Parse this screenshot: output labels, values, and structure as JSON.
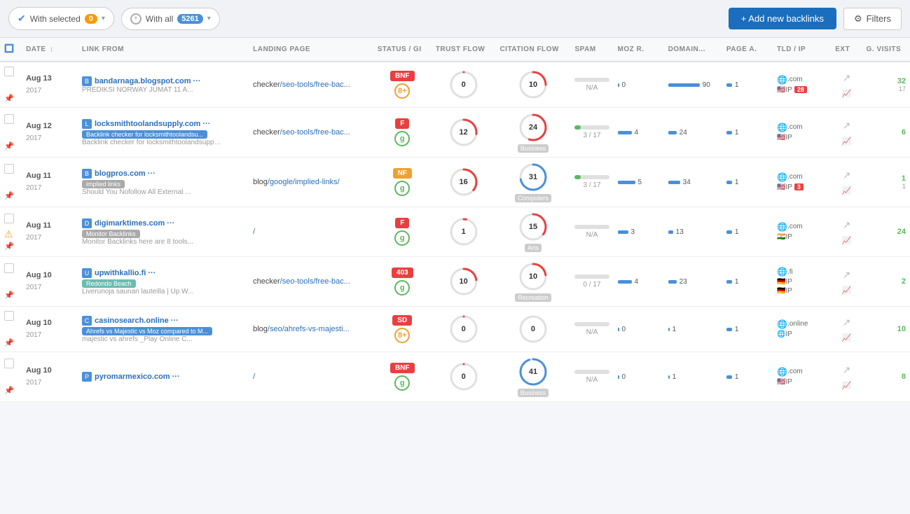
{
  "toolbar": {
    "with_selected_label": "With selected",
    "with_selected_count": "0",
    "with_all_label": "With all",
    "with_all_count": "5261",
    "add_backlinks_label": "+ Add new backlinks",
    "filters_label": "Filters"
  },
  "table": {
    "headers": [
      {
        "key": "date",
        "label": "DATE",
        "sortable": true
      },
      {
        "key": "link",
        "label": "LINK FROM",
        "sortable": false
      },
      {
        "key": "landing",
        "label": "LANDING PAGE",
        "sortable": false
      },
      {
        "key": "status",
        "label": "STATUS / GI",
        "sortable": false
      },
      {
        "key": "trust",
        "label": "TRUST FLOW",
        "sortable": false
      },
      {
        "key": "citation",
        "label": "CITATION FLOW",
        "sortable": false
      },
      {
        "key": "spam",
        "label": "SPAM",
        "sortable": false
      },
      {
        "key": "moz_r",
        "label": "MOZ R.",
        "sortable": false
      },
      {
        "key": "domain",
        "label": "DOMAIN...",
        "sortable": false
      },
      {
        "key": "page_a",
        "label": "PAGE A.",
        "sortable": false
      },
      {
        "key": "tld_ip",
        "label": "TLD / IP",
        "sortable": false
      },
      {
        "key": "ext",
        "label": "EXT",
        "sortable": false
      },
      {
        "key": "g_visits",
        "label": "G. VISITS",
        "sortable": false
      }
    ],
    "rows": [
      {
        "date": {
          "day": "Aug 13",
          "year": "2017"
        },
        "link_domain": "bandarnaga.blogspot.com",
        "link_sub": "PREDIKSI NORWAY JUMAT 11 A...",
        "link_tag": null,
        "link_icon": "blog",
        "landing_prefix": "checker",
        "landing_path": "/seo-tools/free-bac...",
        "status_code": "BNF",
        "status_class": "status-bnf",
        "g_icon_class": "g-orange",
        "g_icon_text": "8+",
        "trust_val": 0,
        "trust_arc_color": "#e84040",
        "trust_arc_pct": 0,
        "citation_val": 10,
        "citation_arc_color": "#e84040",
        "citation_arc_pct": 25,
        "spam_val": "N/A",
        "spam_bar_pct": 0,
        "moz_r_val": 0,
        "moz_r_bar": 0,
        "domain_val": 90,
        "domain_bar": 90,
        "page_a_val": 1,
        "tld": ".com",
        "ip_flag": "🇺🇸",
        "ip_badge": "28",
        "ip_badge_class": "ip-red",
        "ext_icon": "↗",
        "visits_val": "32",
        "visits_sub": "17",
        "has_warning": false
      },
      {
        "date": {
          "day": "Aug 12",
          "year": "2017"
        },
        "link_domain": "locksmithtoolandsupply.com",
        "link_sub": "Backlink checker for locksmithtoolandsupply...",
        "link_tag": "Backlink checker for locksmithtoolandsu...",
        "link_tag_text": "Backlink checker for locksmithtoolandsu...",
        "link_tag_class": "tag-blue",
        "link_icon": "list",
        "landing_prefix": "checker",
        "landing_path": "/seo-tools/free-bac...",
        "status_code": "F",
        "status_class": "status-f",
        "g_icon_class": "g-green",
        "g_icon_text": "g",
        "trust_val": 12,
        "trust_arc_color": "#e84040",
        "trust_arc_pct": 27,
        "citation_val": 24,
        "citation_arc_color": "#e84040",
        "citation_arc_pct": 55,
        "citation_category": "Business",
        "spam_val": "3 / 17",
        "spam_bar_pct": 18,
        "moz_r_val": 4,
        "moz_r_bar": 15,
        "domain_val": 24,
        "domain_bar": 24,
        "page_a_val": 1,
        "tld": ".com",
        "ip_flag": "🇺🇸",
        "ip_badge": null,
        "ip_badge_class": null,
        "ext_icon": "↗",
        "visits_val": "6",
        "visits_sub": "",
        "has_warning": false
      },
      {
        "date": {
          "day": "Aug 11",
          "year": "2017"
        },
        "link_domain": "blogpros.com",
        "link_sub": "Should You Nofollow All External ...",
        "link_tag_text": "implied links",
        "link_tag_class": "tag-gray",
        "link_icon": "b",
        "landing_prefix": "blog",
        "landing_path": "/google/implied-links/",
        "status_code": "NF",
        "status_class": "status-nf",
        "g_icon_class": "g-green",
        "g_icon_text": "g",
        "trust_val": 16,
        "trust_arc_color": "#e84040",
        "trust_arc_pct": 36,
        "citation_val": 31,
        "citation_arc_color": "#4a90d9",
        "citation_arc_pct": 72,
        "citation_category": "Computers",
        "spam_val": "3 / 17",
        "spam_bar_pct": 18,
        "moz_r_val": 5,
        "moz_r_bar": 20,
        "domain_val": 34,
        "domain_bar": 34,
        "page_a_val": 1,
        "tld": ".com",
        "ip_flag": "🇺🇸",
        "ip_badge": "3",
        "ip_badge_class": "ip-red",
        "ext_icon": "↗",
        "visits_val": "1",
        "visits_sub": "1",
        "has_warning": false
      },
      {
        "date": {
          "day": "Aug 11",
          "year": "2017"
        },
        "link_domain": "digimarktimes.com",
        "link_sub": "Monitor Backlinks here are 8 tools...",
        "link_tag_text": "Monitor Backlinks",
        "link_tag_class": "tag-gray",
        "link_icon": "d",
        "landing_prefix": "",
        "landing_path": "/",
        "status_code": "F",
        "status_class": "status-f",
        "g_icon_class": "g-green",
        "g_icon_text": "g",
        "trust_val": 1,
        "trust_arc_color": "#e84040",
        "trust_arc_pct": 3,
        "citation_val": 15,
        "citation_arc_color": "#e84040",
        "citation_arc_pct": 35,
        "citation_category": "Arts",
        "spam_val": "N/A",
        "spam_bar_pct": 0,
        "moz_r_val": 3,
        "moz_r_bar": 12,
        "domain_val": 13,
        "domain_bar": 13,
        "page_a_val": 1,
        "tld": ".com",
        "ip_flag": "🇮🇳",
        "ip_badge": null,
        "ip_badge_class": null,
        "ext_icon": "↗",
        "visits_val": "24",
        "visits_sub": "",
        "has_warning": true
      },
      {
        "date": {
          "day": "Aug 10",
          "year": "2017"
        },
        "link_domain": "upwithkallio.fi",
        "link_sub": "Liverunoja saunan lauteilla | Up W...",
        "link_tag_text": "Redondo Beach",
        "link_tag_class": "tag-teal",
        "link_icon": "u",
        "landing_prefix": "checker",
        "landing_path": "/seo-tools/free-bac...",
        "status_code": "403",
        "status_class": "status-403",
        "g_icon_class": "g-green",
        "g_icon_text": "g",
        "trust_val": 10,
        "trust_arc_color": "#e84040",
        "trust_arc_pct": 23,
        "citation_val": 10,
        "citation_arc_color": "#e84040",
        "citation_arc_pct": 23,
        "citation_category": "Recreation",
        "spam_val": "0 / 17",
        "spam_bar_pct": 0,
        "moz_r_val": 4,
        "moz_r_bar": 15,
        "domain_val": 23,
        "domain_bar": 23,
        "page_a_val": 1,
        "tld": ".fi",
        "ip_flag": "🇩🇪",
        "ip_badge": null,
        "ip_badge_class": null,
        "ext_icon": "↗",
        "visits_val": "2",
        "visits_sub": "",
        "has_warning": false,
        "tld2": "🇩🇪"
      },
      {
        "date": {
          "day": "Aug 10",
          "year": "2017"
        },
        "link_domain": "casinosearch.online",
        "link_sub": "majestic vs ahrefs _Play Online C...",
        "link_tag_text": "Ahrefs vs Majestic vs Moz compared to M...",
        "link_tag_class": "tag-blue",
        "link_icon": "c",
        "landing_prefix": "blog",
        "landing_path": "/seo/ahrefs-vs-majesti...",
        "status_code": "SD",
        "status_class": "status-sd",
        "g_icon_class": "g-orange",
        "g_icon_text": "8+",
        "trust_val": 0,
        "trust_arc_color": "#e84040",
        "trust_arc_pct": 0,
        "citation_val": 0,
        "citation_arc_color": "#e0e0e0",
        "citation_arc_pct": 0,
        "citation_category": null,
        "spam_val": "N/A",
        "spam_bar_pct": 0,
        "moz_r_val": 0,
        "moz_r_bar": 0,
        "domain_val": 1,
        "domain_bar": 2,
        "page_a_val": 1,
        "tld": ".online",
        "ip_flag": "🌐",
        "ip_badge": null,
        "ip_badge_class": null,
        "ext_icon": "↗",
        "visits_val": "10",
        "visits_sub": "",
        "has_warning": false
      },
      {
        "date": {
          "day": "Aug 10",
          "year": "2017"
        },
        "link_domain": "pyromarmexico.com",
        "link_sub": "",
        "link_tag_text": null,
        "link_tag_class": null,
        "link_icon": "p",
        "landing_prefix": "",
        "landing_path": "/",
        "status_code": "BNF",
        "status_class": "status-bnf",
        "g_icon_class": "g-green",
        "g_icon_text": "g",
        "trust_val": 0,
        "trust_arc_color": "#e84040",
        "trust_arc_pct": 0,
        "citation_val": 41,
        "citation_arc_color": "#4a90d9",
        "citation_arc_pct": 95,
        "citation_category": "Business",
        "spam_val": "N/A",
        "spam_bar_pct": 0,
        "moz_r_val": 0,
        "moz_r_bar": 0,
        "domain_val": 1,
        "domain_bar": 2,
        "page_a_val": 1,
        "tld": ".com",
        "ip_flag": "🇺🇸",
        "ip_badge": null,
        "ip_badge_class": null,
        "ext_icon": "↗",
        "visits_val": "8",
        "visits_sub": "",
        "has_warning": false
      }
    ]
  }
}
